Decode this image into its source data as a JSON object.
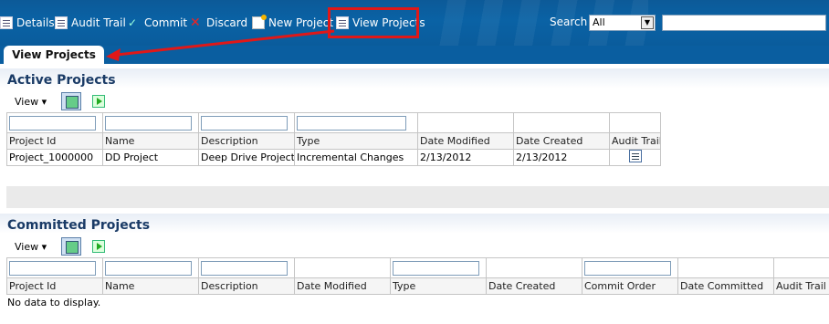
{
  "toolbar": {
    "details": "Details",
    "audit_trail": "Audit Trail",
    "commit": "Commit",
    "discard": "Discard",
    "new_project": "New Project",
    "view_projects": "View Projects",
    "search_label": "Search",
    "search_scope": "All",
    "search_value": ""
  },
  "tab": {
    "label": "View Projects"
  },
  "active": {
    "title": "Active Projects",
    "view_label": "View ▾",
    "columns": [
      "Project Id",
      "Name",
      "Description",
      "Type",
      "Date Modified",
      "Date Created",
      "Audit Trail"
    ],
    "rows": [
      {
        "id": "Project_1000000",
        "name": "DD Project",
        "description": "Deep Drive Project",
        "type": "Incremental Changes",
        "modified": "2/13/2012",
        "created": "2/13/2012"
      }
    ]
  },
  "committed": {
    "title": "Committed Projects",
    "view_label": "View ▾",
    "columns": [
      "Project Id",
      "Name",
      "Description",
      "Date Modified",
      "Type",
      "Date Created",
      "Commit Order",
      "Date Committed",
      "Audit Trail"
    ],
    "empty_text": "No data to display."
  },
  "colors": {
    "toolbar": "#0a62a5",
    "highlight": "#e01818",
    "title": "#1a3b66"
  }
}
